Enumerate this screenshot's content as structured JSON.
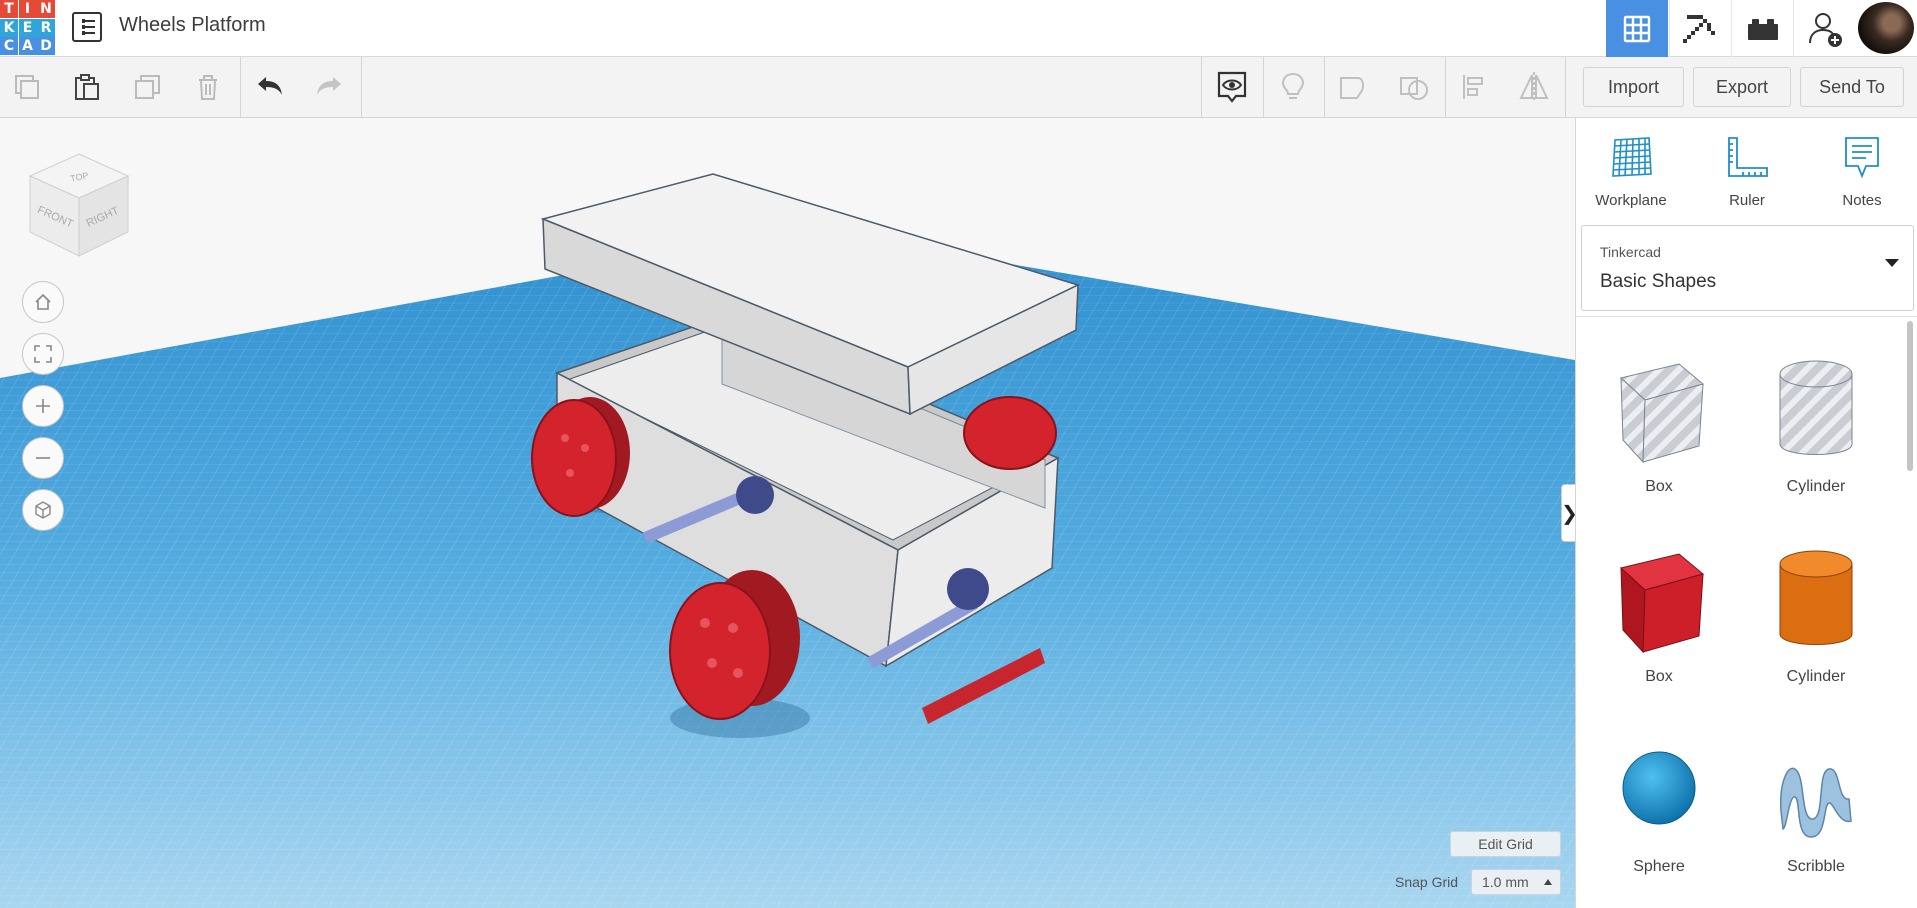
{
  "app": {
    "logo_letters": [
      "T",
      "I",
      "N",
      "K",
      "E",
      "R",
      "C",
      "A",
      "D"
    ],
    "logo_colors": [
      "#e54a36",
      "#e54a36",
      "#e54a36",
      "#2fa6d9",
      "#2fa6d9",
      "#2fa6d9",
      "#4a90e2",
      "#4a90e2",
      "#4a90e2"
    ],
    "title": "Wheels Platform",
    "accent_color": "#4a90e2"
  },
  "topbar_icons": {
    "view_3d": "grid-icon",
    "build": "pickaxe-icon",
    "bricks": "brick-icon",
    "account": "add-user-icon"
  },
  "toolbar": {
    "left_tools": [
      "copy-icon",
      "paste-icon",
      "duplicate-icon",
      "delete-icon",
      "undo-icon",
      "redo-icon"
    ],
    "right_tools": [
      "show-hide-icon",
      "hint-icon",
      "group-icon",
      "ungroup-icon",
      "align-icon",
      "mirror-icon"
    ],
    "import_label": "Import",
    "export_label": "Export",
    "send_to_label": "Send To"
  },
  "viewcube": {
    "top": "TOP",
    "front": "FRONT",
    "right": "RIGHT"
  },
  "viewport": {
    "edit_grid_label": "Edit Grid",
    "snap_grid_label": "Snap Grid",
    "snap_grid_value": "1.0 mm",
    "collapse_glyph": "❯"
  },
  "panel": {
    "tools": [
      {
        "label": "Workplane",
        "icon": "workplane-icon"
      },
      {
        "label": "Ruler",
        "icon": "ruler-icon"
      },
      {
        "label": "Notes",
        "icon": "notes-icon"
      }
    ],
    "library_source": "Tinkercad",
    "library_name": "Basic Shapes",
    "shapes": [
      {
        "label": "Box",
        "icon": "box-hole-icon",
        "color": "#b8bcc4"
      },
      {
        "label": "Cylinder",
        "icon": "cylinder-hole-icon",
        "color": "#c0c4ca"
      },
      {
        "label": "Box",
        "icon": "box-icon",
        "color": "#d0202a"
      },
      {
        "label": "Cylinder",
        "icon": "cylinder-icon",
        "color": "#e2761a"
      },
      {
        "label": "Sphere",
        "icon": "sphere-icon",
        "color": "#1f9ad6"
      },
      {
        "label": "Scribble",
        "icon": "scribble-icon",
        "color": "#8fb7d8"
      }
    ]
  }
}
